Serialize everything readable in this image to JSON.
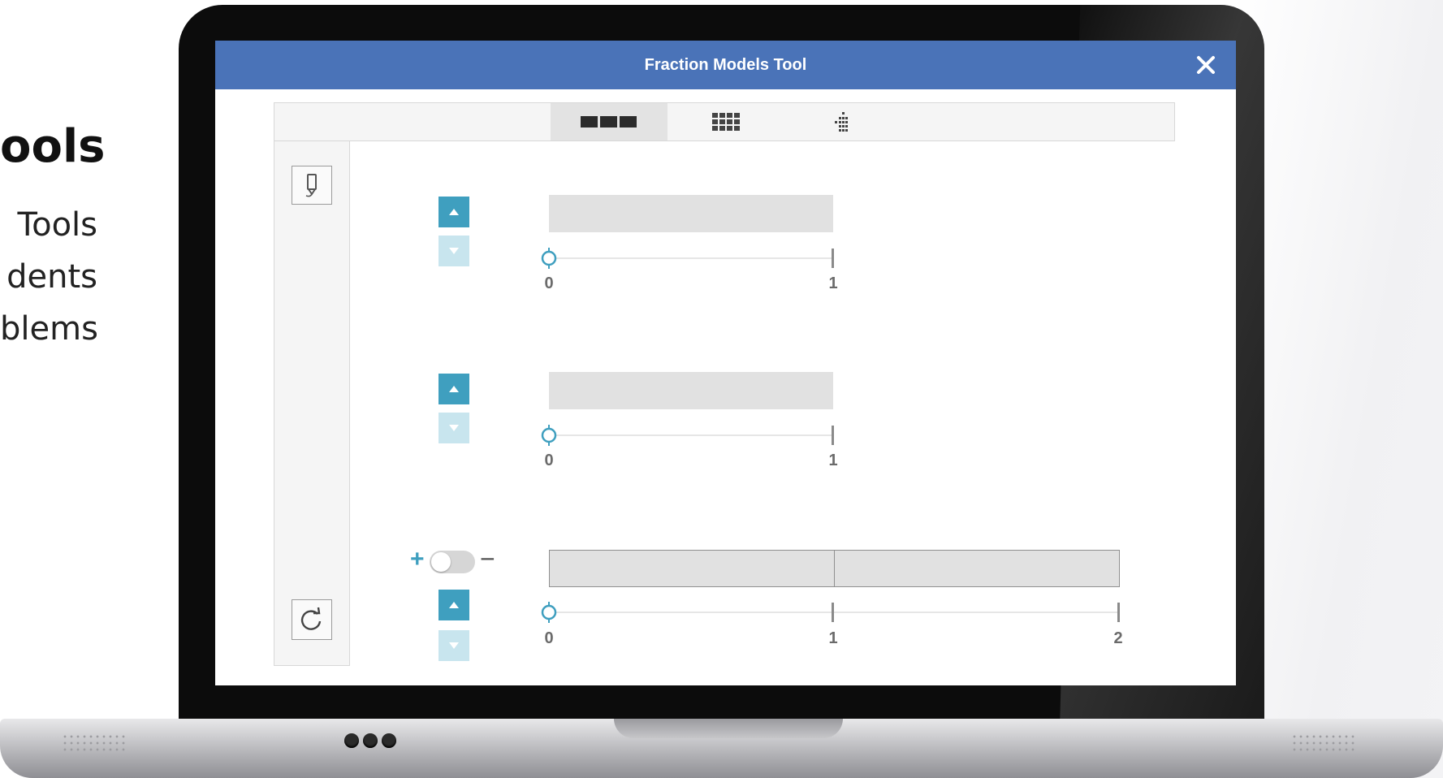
{
  "slide": {
    "heading": "ools",
    "lines": [
      "Tools",
      "dents",
      "blems"
    ]
  },
  "app": {
    "title": "Fraction Models Tool",
    "close_icon": "close-icon",
    "accent": "#4a73b8",
    "stepper_color": "#3f9fbf",
    "tabs": [
      {
        "icon": "bar-model-icon",
        "active": true
      },
      {
        "icon": "area-model-icon",
        "active": false
      },
      {
        "icon": "set-model-icon",
        "active": false
      }
    ],
    "side_tools": [
      {
        "icon": "marker-icon"
      },
      {
        "icon": "reset-icon"
      }
    ],
    "models": [
      {
        "segments": 1,
        "ticks": [
          "0",
          "1"
        ]
      },
      {
        "segments": 1,
        "ticks": [
          "0",
          "1"
        ]
      },
      {
        "segments": 2,
        "ticks": [
          "0",
          "1",
          "2"
        ],
        "toggle": {
          "plus": "+",
          "minus": "−",
          "on": false
        }
      }
    ]
  }
}
